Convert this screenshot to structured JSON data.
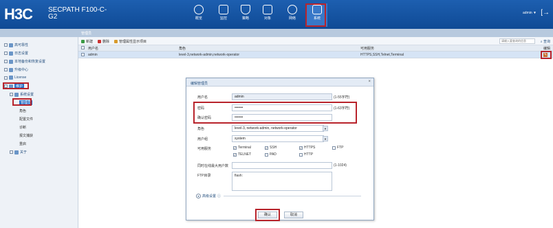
{
  "header": {
    "logo": "H3C",
    "product_line1": "SECPATH F100-C-",
    "product_line2": "G2",
    "nav": [
      {
        "label": "概览",
        "icon": "gauge-icon"
      },
      {
        "label": "监控",
        "icon": "monitor-icon"
      },
      {
        "label": "策略",
        "icon": "shield-icon"
      },
      {
        "label": "对象",
        "icon": "object-icon"
      },
      {
        "label": "网络",
        "icon": "network-icon"
      },
      {
        "label": "系统",
        "icon": "system-icon"
      }
    ],
    "user": "admin ▼",
    "logout": "[→"
  },
  "breadcrumb": "管理员",
  "sidebar": {
    "items": [
      {
        "label": "高可靠性"
      },
      {
        "label": "日志设置"
      },
      {
        "label": "本地备份和恢复设置"
      },
      {
        "label": "升级中心"
      },
      {
        "label": "License"
      },
      {
        "label": "维护"
      },
      {
        "label": "系统设置"
      },
      {
        "label": "关于"
      }
    ],
    "subitems": [
      "管理员",
      "角色",
      "配置文件",
      "诊断",
      "报文捕获",
      "重启"
    ]
  },
  "toolbar": {
    "new": "新建",
    "delete": "删除",
    "manage_display": "管理属性显示项目",
    "search_placeholder": "请输入要查询的信息",
    "search": "查询"
  },
  "table": {
    "headers": [
      "用户名",
      "角色",
      "可用服务",
      "编辑"
    ],
    "rows": [
      {
        "user": "admin",
        "role": "level-3,network-admin,network-operator",
        "services": "HTTPS,SSH,Telnet,Terminal"
      }
    ]
  },
  "modal": {
    "title": "编辑管理员",
    "username_label": "用户名",
    "username_value": "admin",
    "username_hint": "(1-55字符)",
    "password_label": "密码",
    "password_value": "•••••••",
    "password_hint": "(1-63字符)",
    "confirm_label": "确认密码",
    "confirm_value": "•••••••",
    "role_label": "角色",
    "role_value": "level-3, network-admin, network-operator",
    "group_label": "用户组",
    "group_value": "system",
    "service_label": "可用服务",
    "services": [
      {
        "label": "Terminal",
        "checked": true
      },
      {
        "label": "SSH",
        "checked": true
      },
      {
        "label": "HTTPS",
        "checked": true
      },
      {
        "label": "FTP",
        "checked": false
      },
      {
        "label": "TELNET",
        "checked": true
      },
      {
        "label": "PAD",
        "checked": false
      },
      {
        "label": "HTTP",
        "checked": false
      }
    ],
    "idle_label": "同时在线最大用户数",
    "idle_hint": "(1-1024)",
    "ftp_label": "FTP目录",
    "ftp_value": "flash:",
    "advanced": "高级设置",
    "ok": "确认",
    "cancel": "取消"
  },
  "colors": {
    "header": "#1558a8",
    "highlight": "#b8232b",
    "selection": "#2a6fc6"
  }
}
